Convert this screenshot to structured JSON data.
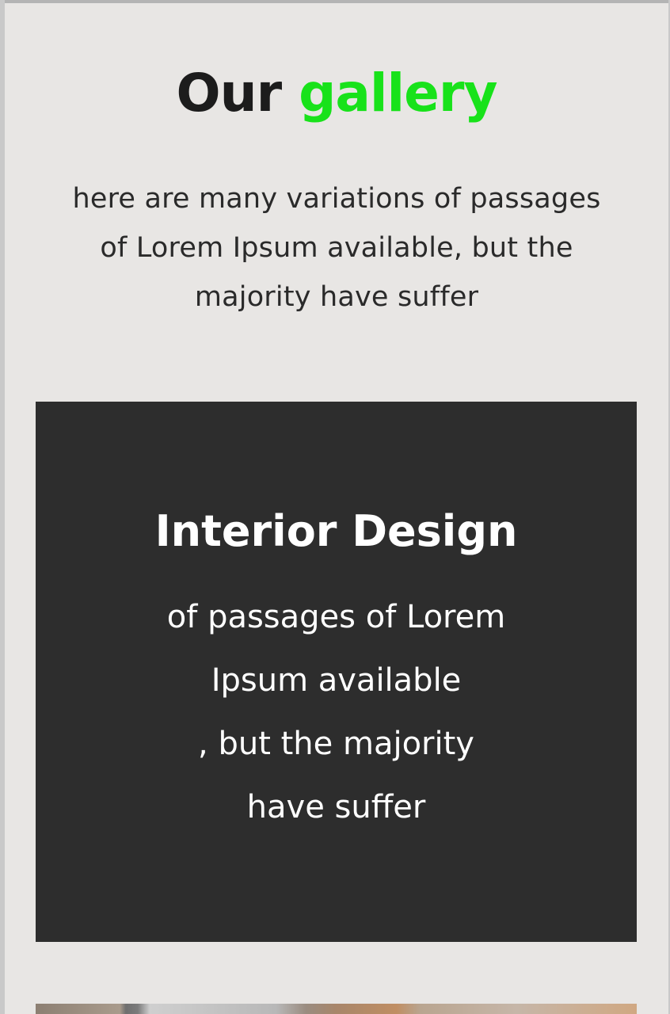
{
  "gallery": {
    "title_part1": "Our",
    "title_part2": "gallery",
    "accent_color": "#18e21a",
    "intro_lines": [
      "here are many variations of passages",
      "of Lorem Ipsum available, but the",
      "majority have suffer"
    ]
  },
  "card": {
    "title": "Interior Design",
    "body_lines": [
      "of passages of Lorem",
      "Ipsum available",
      ", but the majority",
      "have suffer"
    ],
    "background_color": "#2d2d2d"
  }
}
